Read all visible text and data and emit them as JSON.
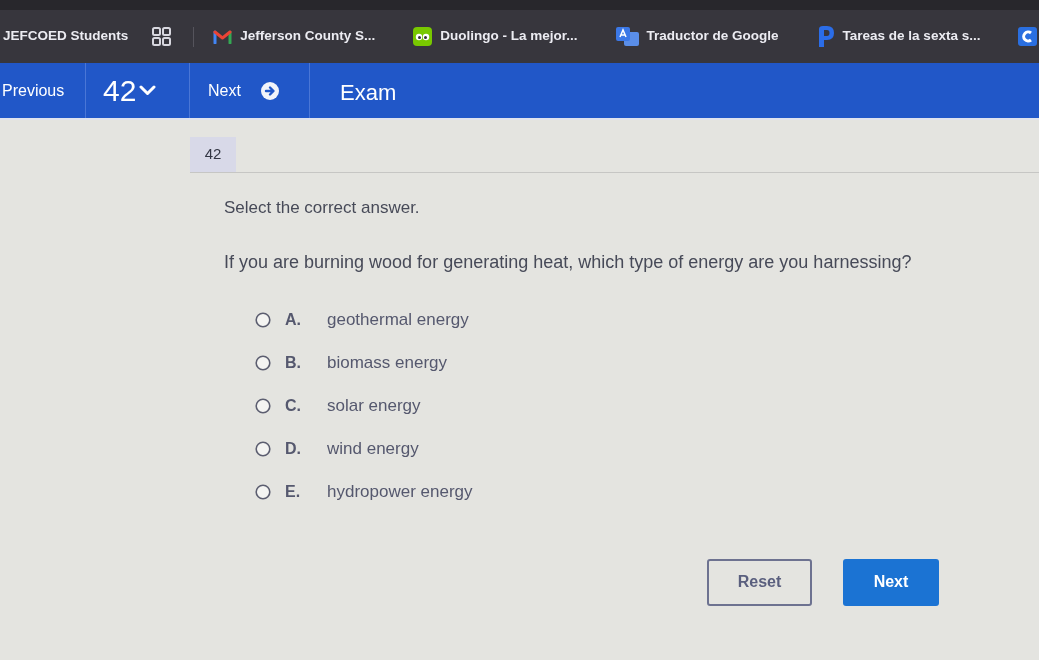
{
  "bookmarks_bar": {
    "folder": "JEFCOED Students",
    "bookmarks": [
      "Jefferson County S...",
      "Duolingo - La mejor...",
      "Traductor de Google",
      "Tareas de la sexta s..."
    ]
  },
  "toolbar": {
    "previous": "Previous",
    "question_number": "42",
    "next": "Next",
    "title": "Exam"
  },
  "question": {
    "number": "42",
    "instruction": "Select the correct answer.",
    "prompt": "If you are burning wood for generating heat, which type of energy are you harnessing?",
    "options": [
      {
        "letter": "A.",
        "text": "geothermal energy",
        "selected": false
      },
      {
        "letter": "B.",
        "text": "biomass energy",
        "selected": false
      },
      {
        "letter": "C.",
        "text": "solar energy",
        "selected": false
      },
      {
        "letter": "D.",
        "text": "wind energy",
        "selected": false
      },
      {
        "letter": "E.",
        "text": "hydropower energy",
        "selected": false
      }
    ]
  },
  "buttons": [
    {
      "label": "Reset",
      "kind": "secondary"
    },
    {
      "label": "Next",
      "kind": "primary"
    }
  ]
}
